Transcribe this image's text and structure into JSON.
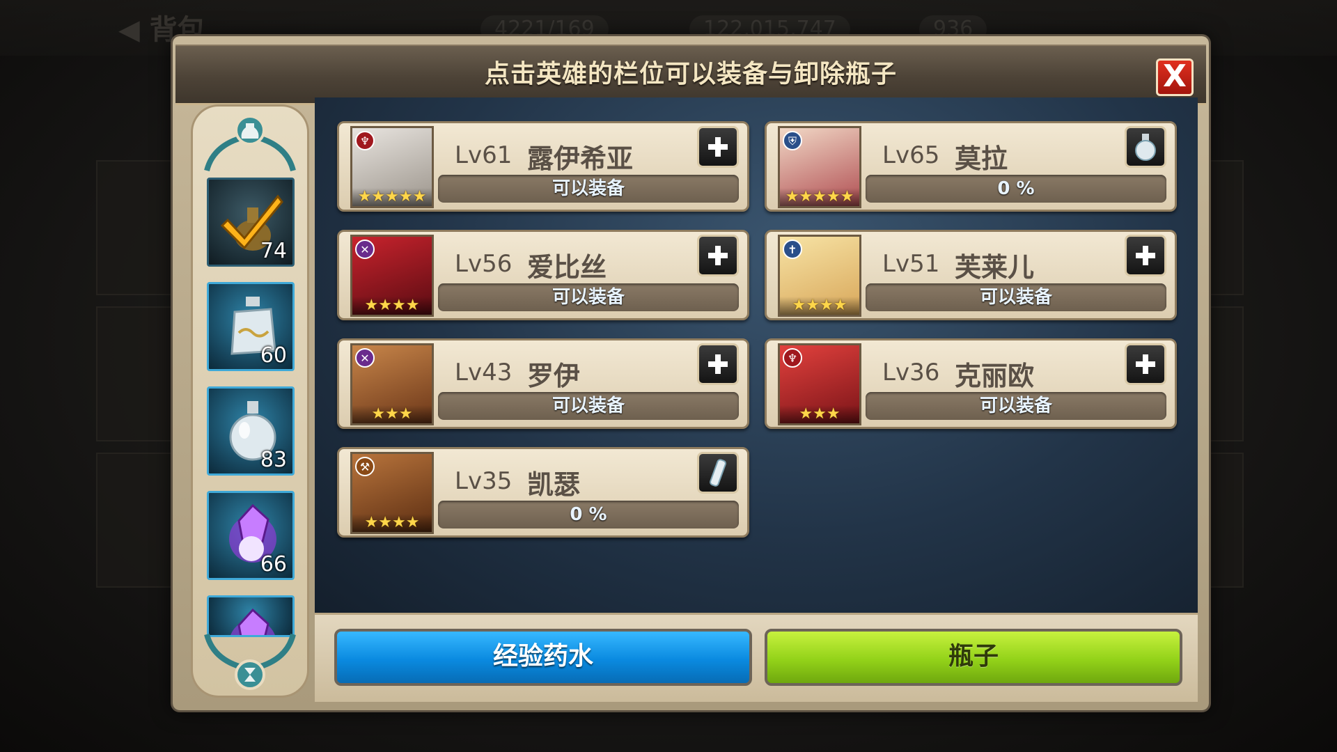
{
  "background": {
    "back_label": "背包",
    "resources": [
      "4221/169",
      "122,015,747",
      "936"
    ]
  },
  "dialog": {
    "title": "点击英雄的栏位可以装备与卸除瓶子",
    "close_label": "X"
  },
  "sidebar": {
    "items": [
      {
        "icon": "exp-potion-checked-icon",
        "count": "74",
        "selected": true
      },
      {
        "icon": "square-bottle-icon",
        "count": "60",
        "selected": false
      },
      {
        "icon": "round-bottle-icon",
        "count": "83",
        "selected": false
      },
      {
        "icon": "purple-crystal-bottle-icon",
        "count": "66",
        "selected": false
      },
      {
        "icon": "purple-crystal-bottle-icon",
        "count": "",
        "selected": false
      }
    ]
  },
  "heroes": [
    {
      "level": "Lv61",
      "name": "露伊希亚",
      "status": "可以装备",
      "action": "plus",
      "stars": "★★★★★",
      "class_icon": "staff-icon",
      "class_color": "#a0181e",
      "portrait": [
        "#e8e4df",
        "#9b948b"
      ]
    },
    {
      "level": "Lv65",
      "name": "莫拉",
      "status": "0 %",
      "action": "bottle",
      "stars": "★★★★★",
      "class_icon": "shield-icon",
      "class_color": "#2a4f8a",
      "portrait": [
        "#f1d8c6",
        "#b04e52"
      ]
    },
    {
      "level": "Lv56",
      "name": "爱比丝",
      "status": "可以装备",
      "action": "plus",
      "stars": "★★★★",
      "class_icon": "crossed-swords-icon",
      "class_color": "#6a2b8c",
      "portrait": [
        "#c8232d",
        "#5a0c12"
      ]
    },
    {
      "level": "Lv51",
      "name": "芙莱儿",
      "status": "可以装备",
      "action": "plus",
      "stars": "★★★★",
      "class_icon": "cross-icon",
      "class_color": "#2a4f8a",
      "portrait": [
        "#f7e3a5",
        "#d8a75a"
      ]
    },
    {
      "level": "Lv43",
      "name": "罗伊",
      "status": "可以装备",
      "action": "plus",
      "stars": "★★★",
      "class_icon": "crossed-swords-icon",
      "class_color": "#6a2b8c",
      "portrait": [
        "#c8864a",
        "#6b3618"
      ]
    },
    {
      "level": "Lv36",
      "name": "克丽欧",
      "status": "可以装备",
      "action": "plus",
      "stars": "★★★",
      "class_icon": "staff-icon",
      "class_color": "#a0181e",
      "portrait": [
        "#e2413d",
        "#7a1418"
      ]
    },
    {
      "level": "Lv35",
      "name": "凯瑟",
      "status": "0 %",
      "action": "bottle",
      "stars": "★★★★",
      "class_icon": "axe-icon",
      "class_color": "#8a4a16",
      "portrait": [
        "#b8743c",
        "#5c2e12"
      ]
    }
  ],
  "buttons": {
    "exp_potion": "经验药水",
    "bottle": "瓶子"
  },
  "colors": {
    "exp_button": "#0a8ae0",
    "bottle_button": "#93d219",
    "close_button": "#d02a1a"
  }
}
